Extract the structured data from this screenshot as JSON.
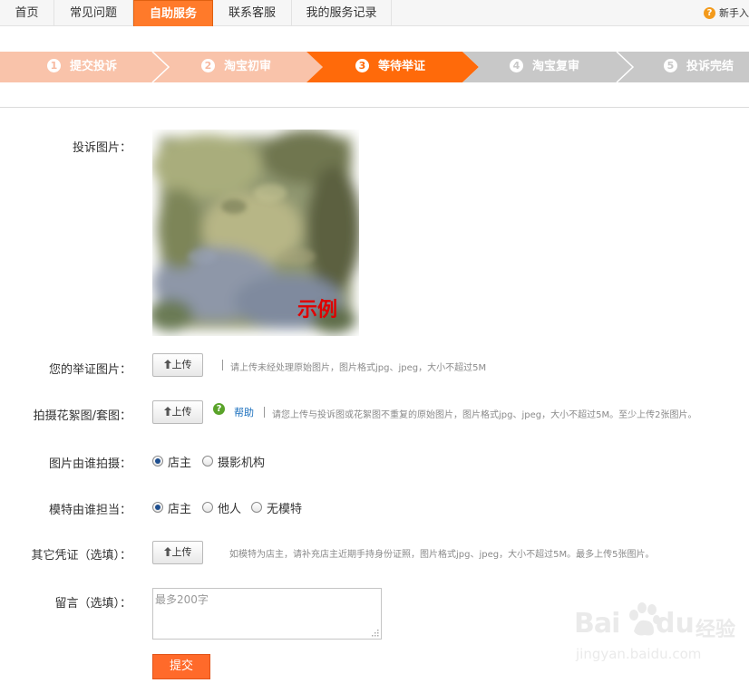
{
  "nav": {
    "tabs": [
      {
        "label": "首页"
      },
      {
        "label": "常见问题"
      },
      {
        "label": "自助服务"
      },
      {
        "label": "联系客服"
      },
      {
        "label": "我的服务记录"
      }
    ],
    "newbie": "新手入"
  },
  "steps": [
    {
      "num": "1",
      "label": "提交投诉",
      "state": "done"
    },
    {
      "num": "2",
      "label": "淘宝初审",
      "state": "done"
    },
    {
      "num": "3",
      "label": "等待举证",
      "state": "current"
    },
    {
      "num": "4",
      "label": "淘宝复审",
      "state": "todo"
    },
    {
      "num": "5",
      "label": "投诉完结",
      "state": "todo"
    }
  ],
  "form": {
    "complaint_image_label": "投诉图片：",
    "sample_text": "示例",
    "evidence": {
      "label": "您的举证图片：",
      "button": "上传",
      "hint": "请上传未经处理原始图片，图片格式jpg、jpeg，大小不超过5M"
    },
    "pattern": {
      "label": "拍摄花絮图/套图：",
      "button": "上传",
      "help": "帮助",
      "hint": "请您上传与投诉图或花絮图不重复的原始图片，图片格式jpg、jpeg，大小不超过5M。至少上传2张图片。"
    },
    "photographer": {
      "label": "图片由谁拍摄：",
      "options": [
        "店主",
        "摄影机构"
      ],
      "selected": "店主"
    },
    "model": {
      "label": "模特由谁担当：",
      "options": [
        "店主",
        "他人",
        "无模特"
      ],
      "selected": "店主"
    },
    "other": {
      "label": "其它凭证（选填）：",
      "button": "上传",
      "hint": "如模特为店主，请补充店主近期手持身份证照，图片格式jpg、jpeg，大小不超过5M。最多上传5张图片。"
    },
    "message": {
      "label": "留言（选填）：",
      "placeholder": "最多200字"
    },
    "submit": "提交"
  },
  "watermark": {
    "brand": "Bai",
    "brand2": "du",
    "cn": "经验",
    "url": "jingyan.baidu.com"
  },
  "colors": {
    "accent": "#ff6a0a",
    "step_done": "#f9c3aa",
    "step_todo": "#c8c8c8"
  }
}
